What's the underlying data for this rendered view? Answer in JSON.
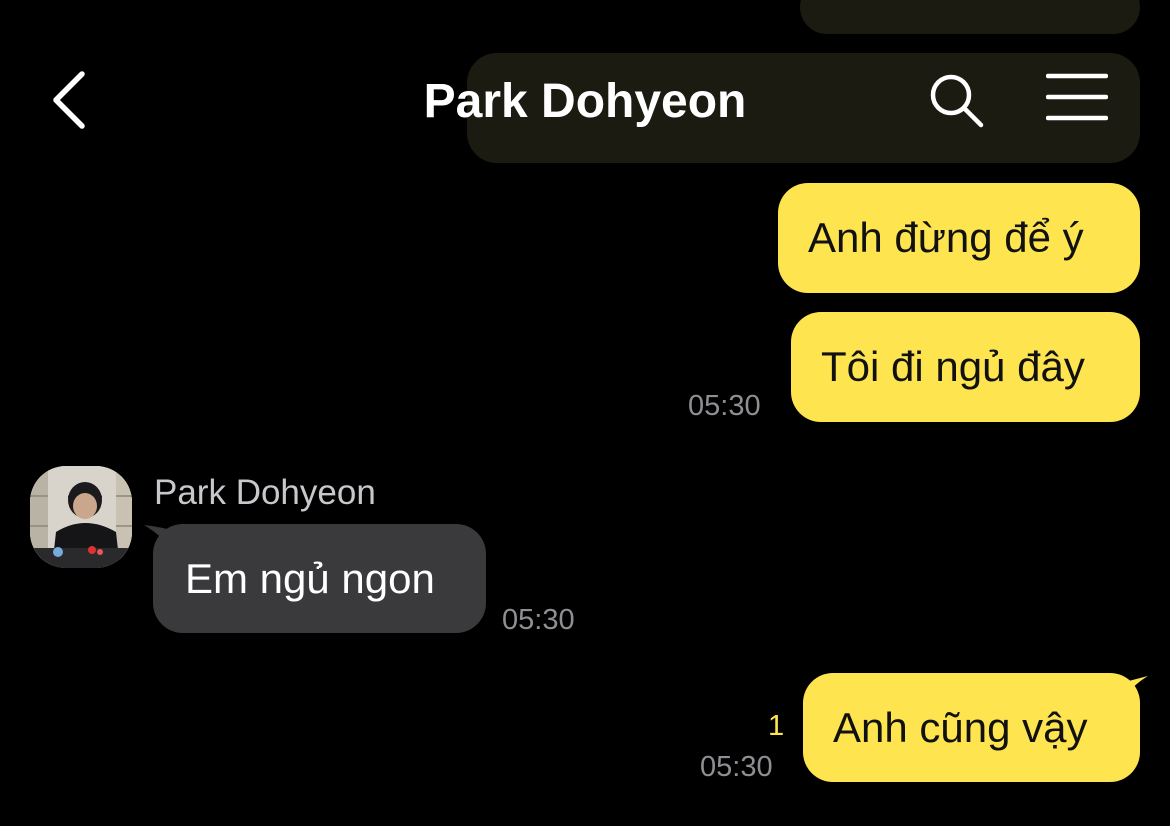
{
  "header": {
    "title": "Park Dohyeon",
    "back_icon": "chevron-left-icon",
    "search_icon": "search-icon",
    "menu_icon": "hamburger-menu-icon"
  },
  "messages": [
    {
      "direction": "outgoing",
      "text": "Anh đừng để ý",
      "time": ""
    },
    {
      "direction": "outgoing",
      "text": "Tôi đi ngủ đây",
      "time": "05:30"
    },
    {
      "direction": "incoming",
      "sender": "Park Dohyeon",
      "text": "Em ngủ ngon",
      "time": "05:30"
    },
    {
      "direction": "outgoing",
      "text": "Anh cũng vậy",
      "time": "05:30",
      "unread_count": "1"
    }
  ],
  "colors": {
    "outgoing_bubble": "#FEE54F",
    "incoming_bubble": "#3A3A3C",
    "background": "#000000",
    "unread_indicator": "#FEE54F"
  }
}
